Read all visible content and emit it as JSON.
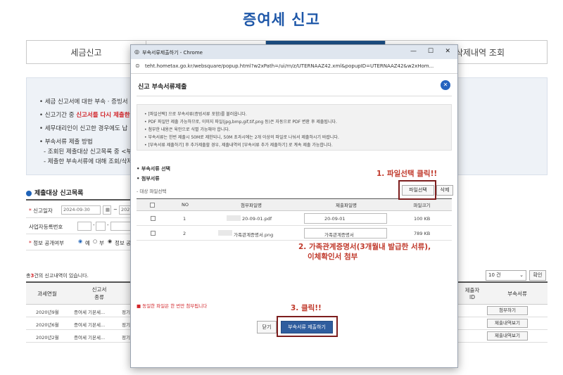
{
  "page": {
    "title": "증여세 신고",
    "tabs": [
      "세금신고",
      "",
      "",
      "삭제내역 조회"
    ],
    "info": {
      "line1": "세금 신고서에 대한 부속 · 증빙서",
      "line2a": "신고기간 중 ",
      "line2b": "신고서를 다시 제출한",
      "line3": "세무대리인이 신고한 경우에도 납",
      "line4": "부속서류 제출 방법",
      "line5": "- 조회된 제출대상 신고목록 중 <부",
      "line6": "- 제출한 부속서류에 대해 조회/삭제"
    },
    "list_title": "제출대상 신고목록",
    "form": {
      "date_label": "신고일자",
      "date_value": "2024-09-30",
      "date_to": "202",
      "reg_label": "사업자등록번호",
      "public_label": "정보 공개여부",
      "public_yes": "예",
      "public_no": "부",
      "public_note": "정보 공"
    },
    "result_count_prefix": "총",
    "result_count": "3",
    "result_count_suffix": "건의 신고내역이 있습니다.",
    "page_size": "10 건",
    "confirm_label": "확인",
    "table_headers": [
      "과세연월",
      "신고서\n종류",
      "제출자\nID",
      "부속서류"
    ],
    "rows": [
      {
        "period": "2020년9월",
        "type": "증여세 기본세...",
        "mid": "정기",
        "action": "첨부하기"
      },
      {
        "period": "2020년6월",
        "type": "증여세 기본세...",
        "mid": "정기",
        "action": "제출내역보기"
      },
      {
        "period": "2020년2월",
        "type": "증여세 기본세...",
        "mid": "정기",
        "action": "제출내역보기"
      }
    ]
  },
  "popup": {
    "window_title": "부속서류제출하기 - Chrome",
    "url": "teht.hometax.go.kr/websquare/popup.html?w2xPath=/ui/rn/z/UTERNAAZ42.xml&popupID=UTERNAAZ42&w2xHom...",
    "heading": "신고 부속서류제출",
    "notices": [
      "• [파일선택] 으로 부속서류(증빙서류 포함)를 불러옵니다.",
      "• PDF 파일만 제출 가능하므로, 이미지 파일(jpg,bmp,gif,tif,png 등)은 자동으로 PDF 변환 후 제출됩니다.",
      "• 첨부한 내용은 육안으로 식별 가능해야 합니다.",
      "• 부속서류는 한번 제출시 50M로 제한되니, 50M 초과시에는 2개 이상의 파일로 나눠서 제출하시기 바랍니다.",
      "• [부속서류 제출하기] 후 추가제출할 경우, 제출내역의 [부속서류 추가 제출하기] 로 계속 제출 가능합니다."
    ],
    "section_select": "부속서류 선택",
    "section_attach": "첨부서류",
    "target_files_label": "대상 파일선택",
    "btn_file_select": "파일선택",
    "btn_delete": "삭제",
    "table_headers": [
      "NO",
      "첨부파일명",
      "제출파일명",
      "파일크기"
    ],
    "files": [
      {
        "no": "1",
        "attach_name": "20-09-01.pdf",
        "submit_name": "20-09-01",
        "size": "100 KB"
      },
      {
        "no": "2",
        "attach_name": "가족관계증명서.png",
        "submit_name": "가족관계증명서",
        "size": "789 KB"
      }
    ],
    "warning": "■ 동일한 파일은 한 번만 첨부됩니다",
    "btn_close": "닫기",
    "btn_submit": "부속서류 제출하기"
  },
  "annotations": {
    "step1": "1. 파일선택 클릭!!",
    "step2_line1": "2. 가족관계증명서(3개월내 발급한 서류),",
    "step2_line2": "이체확인서 첨부",
    "step3": "3. 클릭!!"
  },
  "colors": {
    "title_blue": "#1e57a8",
    "tab_active": "#1c4f86",
    "annotation_red": "#c0392b",
    "highlight_box": "#7d1e1e",
    "submit_button": "#2f5d9e"
  }
}
